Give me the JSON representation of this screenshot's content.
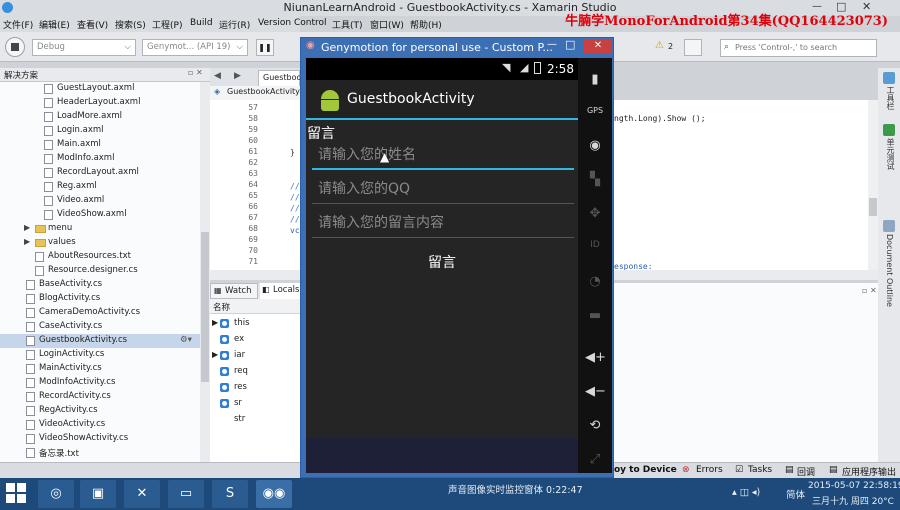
{
  "window": {
    "title": "NiunanLearnAndroid - GuestbookActivity.cs - Xamarin Studio",
    "watermark": "牛腩学MonoForAndroid第34集(QQ164423073)"
  },
  "menu": [
    "文件(F)",
    "编辑(E)",
    "查看(V)",
    "搜索(S)",
    "工程(P)",
    "Build",
    "运行(R)",
    "Version Control",
    "工具(T)",
    "窗口(W)",
    "帮助(H)"
  ],
  "toolbar": {
    "config": "Debug",
    "device": "Genymot... (API 19)",
    "warnings": "2",
    "search_placeholder": "Press 'Control-,' to search"
  },
  "solution": {
    "header": "解决方案",
    "items": [
      {
        "label": "GuestLayout.axml",
        "kind": "file",
        "level": 2
      },
      {
        "label": "HeaderLayout.axml",
        "kind": "file",
        "level": 2
      },
      {
        "label": "LoadMore.axml",
        "kind": "file",
        "level": 2
      },
      {
        "label": "Login.axml",
        "kind": "file",
        "level": 2
      },
      {
        "label": "Main.axml",
        "kind": "file",
        "level": 2
      },
      {
        "label": "ModInfo.axml",
        "kind": "file",
        "level": 2
      },
      {
        "label": "RecordLayout.axml",
        "kind": "file",
        "level": 2
      },
      {
        "label": "Reg.axml",
        "kind": "file",
        "level": 2
      },
      {
        "label": "Video.axml",
        "kind": "file",
        "level": 2
      },
      {
        "label": "VideoShow.axml",
        "kind": "file",
        "level": 2
      },
      {
        "label": "menu",
        "kind": "folder",
        "level": 1
      },
      {
        "label": "values",
        "kind": "folder",
        "level": 1
      },
      {
        "label": "AboutResources.txt",
        "kind": "file",
        "level": 1
      },
      {
        "label": "Resource.designer.cs",
        "kind": "file",
        "level": 1
      },
      {
        "label": "BaseActivity.cs",
        "kind": "file",
        "level": 0
      },
      {
        "label": "BlogActivity.cs",
        "kind": "file",
        "level": 0
      },
      {
        "label": "CameraDemoActivity.cs",
        "kind": "file",
        "level": 0
      },
      {
        "label": "CaseActivity.cs",
        "kind": "file",
        "level": 0
      },
      {
        "label": "GuestbookActivity.cs",
        "kind": "file",
        "level": 0,
        "selected": true
      },
      {
        "label": "LoginActivity.cs",
        "kind": "file",
        "level": 0
      },
      {
        "label": "MainActivity.cs",
        "kind": "file",
        "level": 0
      },
      {
        "label": "ModInfoActivity.cs",
        "kind": "file",
        "level": 0
      },
      {
        "label": "RecordActivity.cs",
        "kind": "file",
        "level": 0
      },
      {
        "label": "RegActivity.cs",
        "kind": "file",
        "level": 0
      },
      {
        "label": "VideoActivity.cs",
        "kind": "file",
        "level": 0
      },
      {
        "label": "VideoShowActivity.cs",
        "kind": "file",
        "level": 0
      },
      {
        "label": "备忘录.txt",
        "kind": "file",
        "level": 0
      }
    ]
  },
  "editor": {
    "tab": "Guestboo",
    "breadcrumb": "GuestbookActivity",
    "line_numbers": [
      "57",
      "58",
      "59",
      "60",
      "61",
      "62",
      "63",
      "64",
      "65",
      "66",
      "67",
      "68",
      "69",
      "70",
      "71"
    ],
    "code_right_1": "ngth.Long).Show ();",
    "code_right_2": "esponse:",
    "code_left_brace": "}",
    "code_left_comments": [
      "//",
      "//",
      "//",
      "//"
    ],
    "code_left_vc": "vc"
  },
  "watch": {
    "tab_watch": "Watch",
    "tab_locals": "Locals",
    "column_name": "名称",
    "rows": [
      "this",
      "ex",
      "iar",
      "req",
      "res",
      "sr",
      "str"
    ]
  },
  "right_dock": [
    "工具栏",
    "单元测试",
    "Document Outline"
  ],
  "statusbar": {
    "deploy": "oy to Device",
    "errors": "Errors",
    "tasks": "Tasks",
    "reply": "回调",
    "app_output": "应用程序输出"
  },
  "emulator": {
    "title": "Genymotion for personal use - Custom P...",
    "time": "2:58",
    "app_title": "GuestbookActivity",
    "section_label": "留言",
    "name_placeholder": "请输入您的姓名",
    "qq_placeholder": "请输入您的QQ",
    "content_placeholder": "请输入您的留言内容",
    "submit_label": "留言",
    "side_icons": [
      "battery-icon",
      "gps-icon",
      "camera-icon",
      "clapper-icon",
      "dpad-icon",
      "id-icon",
      "rss-icon",
      "message-icon",
      "volume-up-icon",
      "volume-down-icon",
      "rotate-icon",
      "fullscreen-icon"
    ]
  },
  "taskbar": {
    "recording_label": "声音图像实时监控窗体 0:22:47",
    "ime": "简体",
    "time": "2015-05-07  22:58:19",
    "date": "三月十九 周四 20°C"
  }
}
